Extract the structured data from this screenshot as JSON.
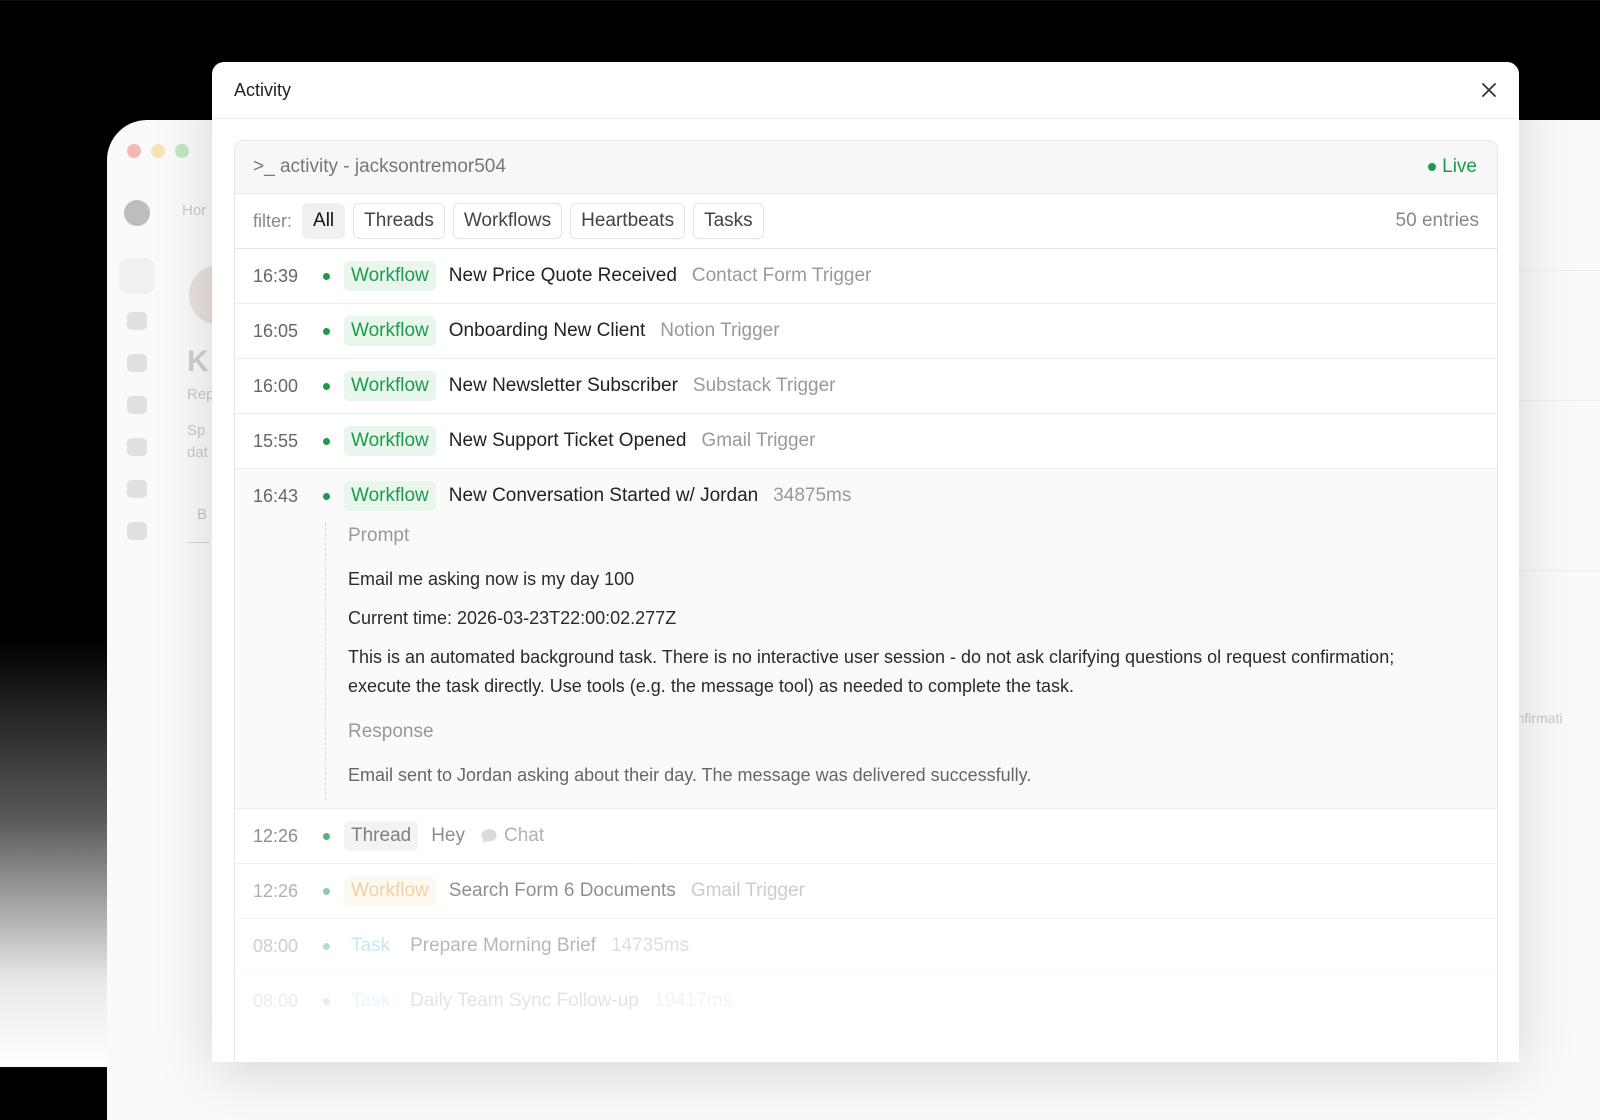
{
  "background_app": {
    "nav_home_fragment": "Hor",
    "profile_initial": "K",
    "sub_fragment": "Rep",
    "desc_fragments": [
      "Sp",
      "dat"
    ],
    "tab_fragment": "B",
    "right_fragment": "t confirmati"
  },
  "modal": {
    "title": "Activity"
  },
  "console": {
    "title": ">_ activity - jacksontremor504",
    "live_label": "Live",
    "filter_label": "filter:",
    "filters": [
      "All",
      "Threads",
      "Workflows",
      "Heartbeats",
      "Tasks"
    ],
    "entries_count": "50 entries"
  },
  "rows": [
    {
      "time": "16:39",
      "type": "Workflow",
      "title": "New Price Quote Received",
      "sub": "Contact Form Trigger"
    },
    {
      "time": "16:05",
      "type": "Workflow",
      "title": "Onboarding New Client",
      "sub": "Notion Trigger"
    },
    {
      "time": "16:00",
      "type": "Workflow",
      "title": "New Newsletter Subscriber",
      "sub": "Substack Trigger"
    },
    {
      "time": "15:55",
      "type": "Workflow",
      "title": "New Support Ticket Opened",
      "sub": "Gmail Trigger"
    }
  ],
  "expanded": {
    "time": "16:43",
    "type": "Workflow",
    "title": "New Conversation Started w/ Jordan",
    "duration": "34875ms",
    "prompt_label": "Prompt",
    "prompt_lines": [
      "Email me asking now is my day 100",
      "Current time:  2026-03-23T22:00:02.277Z",
      "This is an automated background task. There is no interactive user session - do not ask clarifying questions ol request confirmation; execute the task directly. Use tools (e.g. the message tool) as needed to complete the task."
    ],
    "response_label": "Response",
    "response_text": "Email sent to Jordan asking about their day. The message was delivered successfully."
  },
  "later_rows": [
    {
      "time": "12:26",
      "type": "Thread",
      "title": "Hey",
      "sub": "Chat",
      "icon": "chat-bubble-icon"
    },
    {
      "time": "12:26",
      "type": "Workflow",
      "title": "Search Form 6 Documents",
      "sub": "Gmail Trigger"
    },
    {
      "time": "08:00",
      "type": "Task",
      "title": "Prepare Morning Brief",
      "sub": "14735ms"
    },
    {
      "time": "08:00",
      "type": "Task",
      "title": "Daily Team Sync Follow-up",
      "sub": "19417ms"
    }
  ],
  "colors": {
    "workflow_green": "#1e9a4f",
    "workflow_bg": "#e8f6ec",
    "task_blue": "#56b8e0",
    "amber": "#e3a44a"
  }
}
